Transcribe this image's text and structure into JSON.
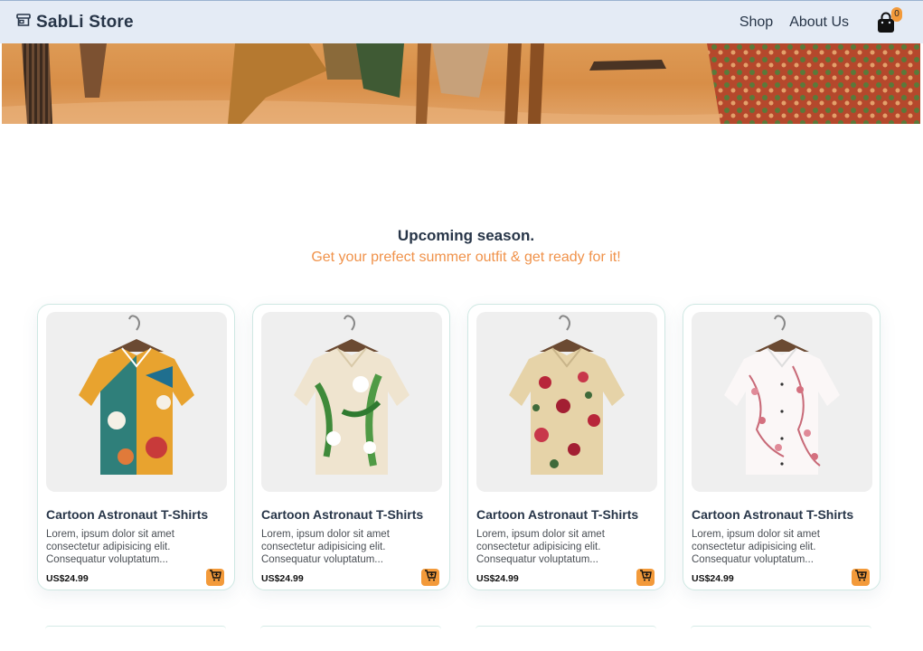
{
  "header": {
    "brand": "SabLi Store",
    "nav": [
      {
        "label": "Shop"
      },
      {
        "label": "About Us"
      }
    ],
    "cart_count": "0",
    "icons": {
      "brand": "store-icon",
      "cart": "shopping-bag-icon"
    }
  },
  "section": {
    "title": "Upcoming season.",
    "subtitle": "Get your prefect summer outfit & get ready for it!"
  },
  "products": [
    {
      "title": "Cartoon Astronaut T-Shirts",
      "desc": [
        "Lorem, ipsum dolor sit amet",
        "consectetur adipisicing elit.",
        "Consequatur voluptatum..."
      ],
      "price": "US$24.99",
      "image": "shirt-abstract-print"
    },
    {
      "title": "Cartoon Astronaut T-Shirts",
      "desc": [
        "Lorem, ipsum dolor sit amet",
        "consectetur adipisicing elit.",
        "Consequatur voluptatum..."
      ],
      "price": "US$24.99",
      "image": "shirt-leaf-print"
    },
    {
      "title": "Cartoon Astronaut T-Shirts",
      "desc": [
        "Lorem, ipsum dolor sit amet",
        "consectetur adipisicing elit.",
        "Consequatur voluptatum..."
      ],
      "price": "US$24.99",
      "image": "shirt-floral-print"
    },
    {
      "title": "Cartoon Astronaut T-Shirts",
      "desc": [
        "Lorem, ipsum dolor sit amet",
        "consectetur adipisicing elit.",
        "Consequatur voluptatum..."
      ],
      "price": "US$24.99",
      "image": "shirt-blossom-print"
    }
  ],
  "colors": {
    "accent": "#f39a3a",
    "nav_bg": "#e4ebf5",
    "heading": "#273548",
    "subtitle": "#f0924a"
  }
}
